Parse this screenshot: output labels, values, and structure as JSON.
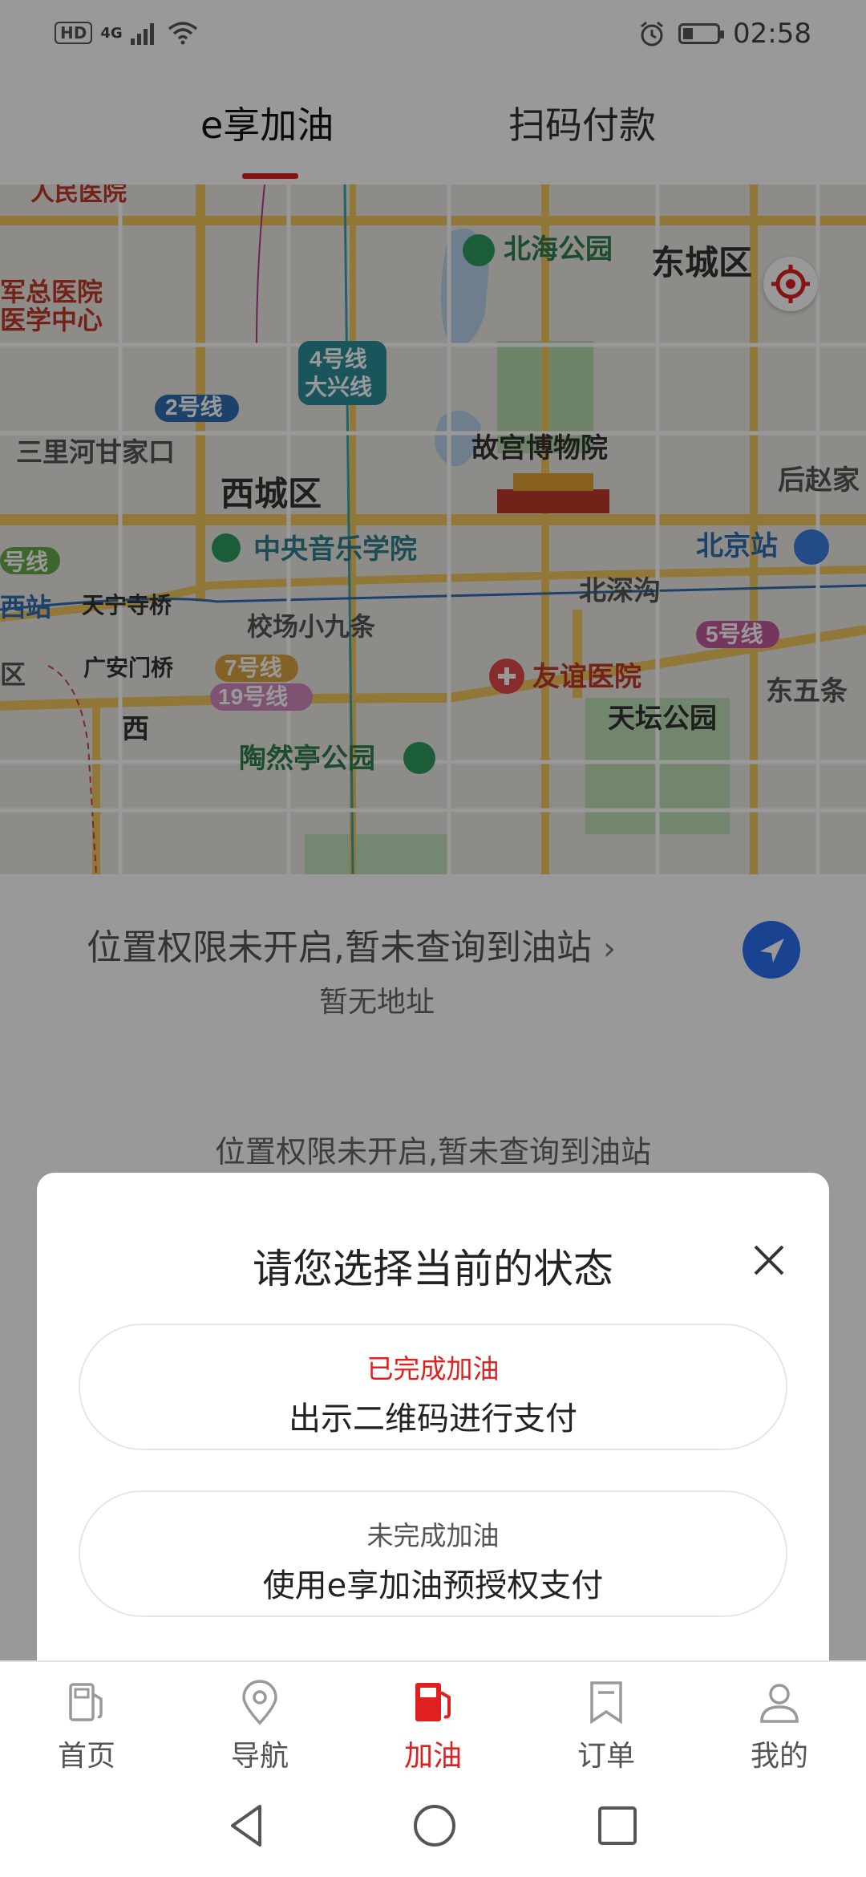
{
  "status_bar": {
    "hd": "HD",
    "network": "4G",
    "time": "02:58",
    "battery_level": 0.3
  },
  "tabs": [
    {
      "label": "e享加油",
      "active": true
    },
    {
      "label": "扫码付款",
      "active": false
    }
  ],
  "map": {
    "labels": [
      "人民医院",
      "4号线",
      "大兴线",
      "北海公园",
      "东城区",
      "军总医院",
      "医学中心",
      "2号线",
      "三里河甘家口",
      "故宫博物院",
      "西城区",
      "后赵家",
      "号线",
      "中央音乐学院",
      "北京站",
      "西站",
      "天宁寺桥",
      "北深沟",
      "校场小九条",
      "5号线",
      "广安门桥",
      "7号线",
      "友谊医院",
      "19号线",
      "东五条",
      "区",
      "天坛公园",
      "西",
      "陶然亭公园"
    ]
  },
  "location": {
    "title": "位置权限未开启,暂未查询到油站",
    "subtitle": "暂无地址",
    "message": "位置权限未开启,暂未查询到油站"
  },
  "modal": {
    "title": "请您选择当前的状态",
    "options": [
      {
        "status": "已完成加油",
        "action": "出示二维码进行支付"
      },
      {
        "status": "未完成加油",
        "action": "使用e享加油预授权支付"
      }
    ]
  },
  "bottom_nav": [
    {
      "label": "首页",
      "icon": "gas-pump-outline-icon",
      "active": false
    },
    {
      "label": "导航",
      "icon": "location-pin-icon",
      "active": false
    },
    {
      "label": "加油",
      "icon": "gas-pump-filled-icon",
      "active": true
    },
    {
      "label": "订单",
      "icon": "bookmark-icon",
      "active": false
    },
    {
      "label": "我的",
      "icon": "user-icon",
      "active": false
    }
  ],
  "colors": {
    "accent": "#e02020",
    "nav_blue": "#2a6ff0"
  }
}
